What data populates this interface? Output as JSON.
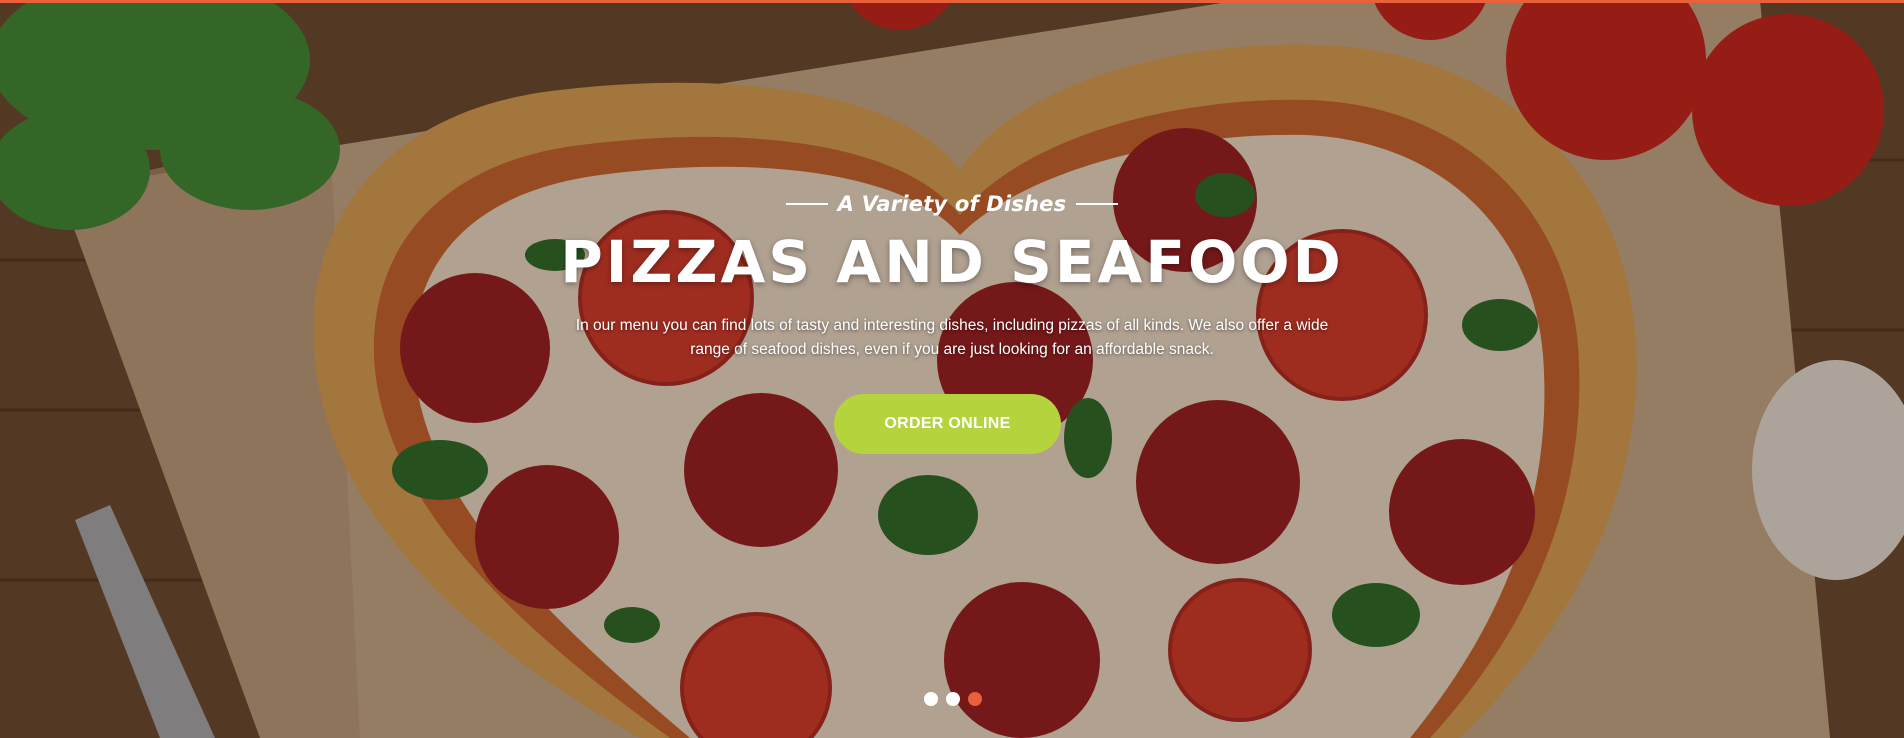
{
  "colors": {
    "accent_bar": "#e8603c",
    "button_bg": "#b5d33c",
    "active_dot": "#e8603c",
    "inactive_dot": "#ffffff"
  },
  "hero": {
    "subtitle": "A Variety of Dishes",
    "title": "PIZZAS AND SEAFOOD",
    "description": "In our menu you can find lots of tasty and interesting dishes, including pizzas of all kinds. We also offer a wide range of seafood dishes, even if you are just looking for an affordable snack.",
    "button_label": "ORDER ONLINE",
    "background_image": "heart-shaped pepperoni pizza with tomatoes, parsley and garlic"
  },
  "slider": {
    "slide_count": 3,
    "active_index": 2
  }
}
